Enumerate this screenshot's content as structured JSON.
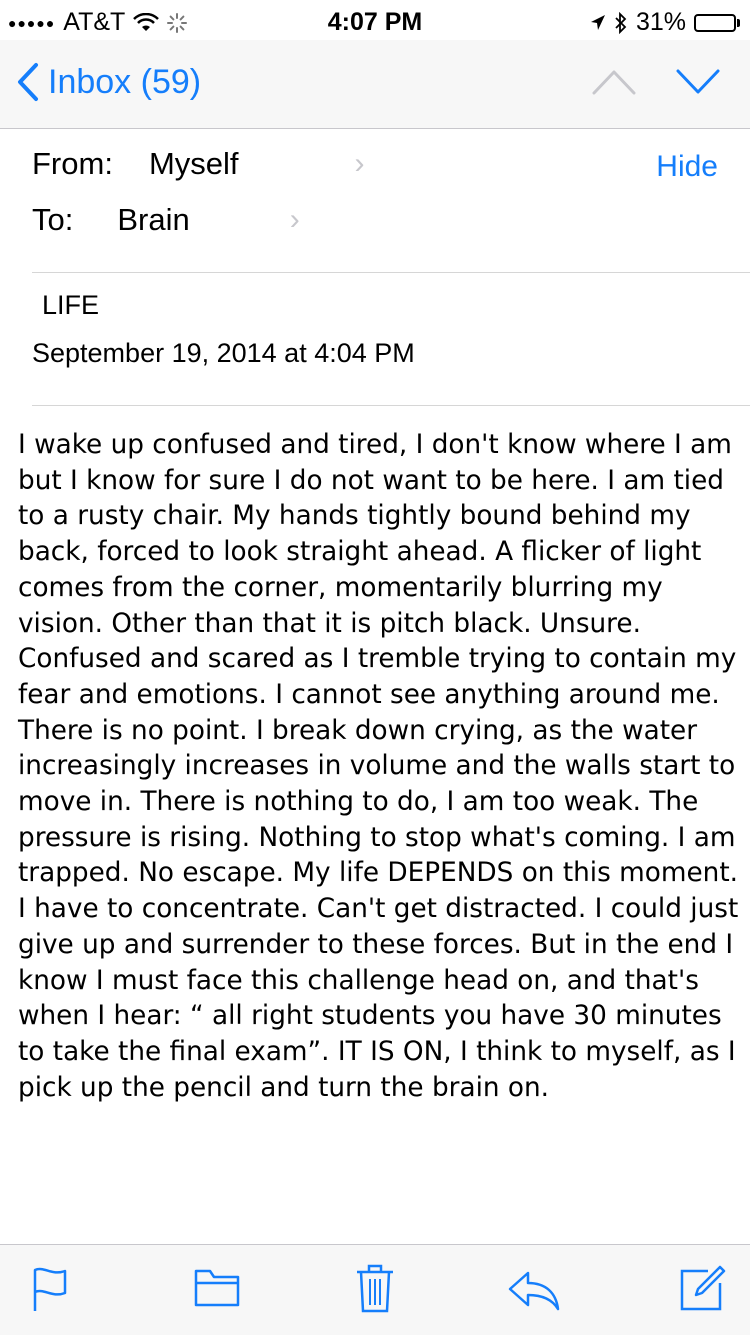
{
  "status": {
    "carrier": "AT&T",
    "time": "4:07 PM",
    "battery": "31%",
    "battery_level": 0.31
  },
  "nav": {
    "back_label": "Inbox (59)"
  },
  "header": {
    "from_label": "From:",
    "from_value": "Myself",
    "to_label": "To:",
    "to_value": "Brain",
    "hide_label": "Hide",
    "subject": "LIFE",
    "date": "September 19, 2014 at 4:04 PM"
  },
  "body": {
    "text": " I wake up confused and tired, I don't know where I am but I know for sure I do not want to be here. I am tied to a rusty chair. My hands tightly bound behind my back, forced to look straight ahead. A flicker of light comes from the corner, momentarily blurring my vision. Other than that it is pitch black. Unsure. Confused and scared as I tremble trying to contain my fear and emotions. I cannot see anything around me. There is no point. I break down crying, as the water increasingly increases in volume and the walls start to move in. There is nothing to do, I am too weak. The pressure is rising. Nothing to stop what's coming. I am trapped. No escape. My life DEPENDS on this moment. I have to concentrate. Can't get distracted. I could just give up and surrender to these forces. But in the end I know I must face this challenge head on, and that's when I hear: “ all right students you have 30 minutes to take the final exam”. IT IS ON, I think to myself, as I pick up the pencil and turn the brain on."
  },
  "toolbar": {
    "icons": [
      "flag-icon",
      "folder-icon",
      "trash-icon",
      "reply-icon",
      "compose-icon"
    ]
  },
  "colors": {
    "accent": "#157efb",
    "chevron": "#c7c7cc",
    "separator": "#d6d6d6",
    "bar_background": "#f7f7f7"
  }
}
